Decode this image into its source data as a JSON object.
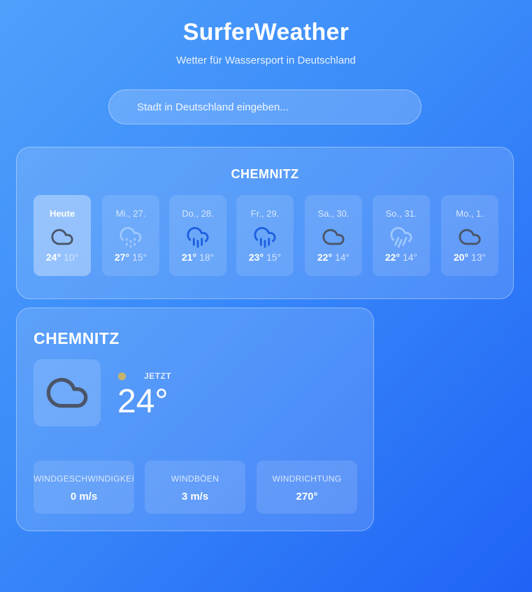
{
  "app": {
    "title": "SurferWeather",
    "subtitle": "Wetter für Wassersport in Deutschland"
  },
  "search": {
    "placeholder": "Stadt in Deutschland eingeben...",
    "value": ""
  },
  "forecast": {
    "city": "CHEMNITZ",
    "days": [
      {
        "label": "Heute",
        "icon": "cloud-icon",
        "max": "24°",
        "min": "10°",
        "active": true
      },
      {
        "label": "Mi., 27.",
        "icon": "drizzle-icon",
        "max": "27°",
        "min": "15°"
      },
      {
        "label": "Do., 28.",
        "icon": "rain-icon",
        "max": "21°",
        "min": "18°"
      },
      {
        "label": "Fr., 29.",
        "icon": "rain-icon",
        "max": "23°",
        "min": "15°"
      },
      {
        "label": "Sa., 30.",
        "icon": "cloud-icon",
        "max": "22°",
        "min": "14°"
      },
      {
        "label": "So., 31.",
        "icon": "showers-icon",
        "max": "22°",
        "min": "14°"
      },
      {
        "label": "Mo., 1.",
        "icon": "cloud-icon",
        "max": "20°",
        "min": "13°"
      }
    ]
  },
  "current": {
    "city": "CHEMNITZ",
    "icon": "cloud-icon",
    "now_label": "JETZT",
    "temperature": "24°",
    "stats": [
      {
        "label": "WINDGESCHWINDIGKEIT",
        "value": "0 m/s"
      },
      {
        "label": "WINDBÖEN",
        "value": "3 m/s"
      },
      {
        "label": "WINDRICHTUNG",
        "value": "270°"
      }
    ]
  },
  "colors": {
    "cloud_icon": "#4a5568",
    "drizzle_icon": "#9ec8ff",
    "rain_icon": "#1c5fe0",
    "status_dot": "#c4b56a"
  }
}
